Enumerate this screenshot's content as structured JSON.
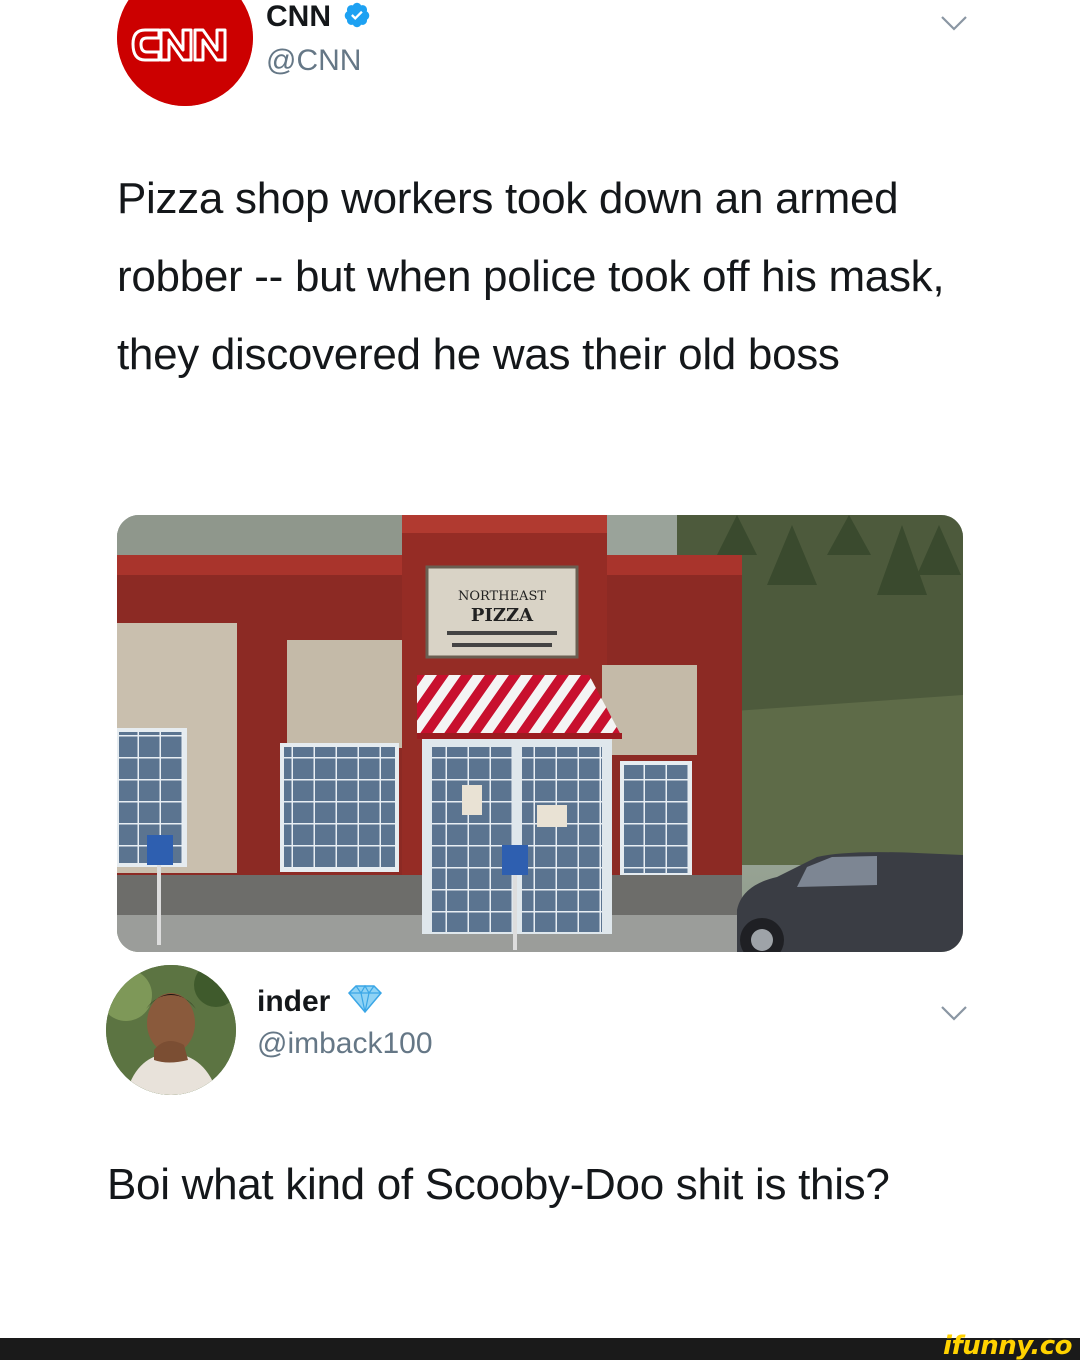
{
  "tweet1": {
    "author_name": "CNN",
    "handle": "@CNN",
    "avatar_logo": "CNN",
    "verified_icon": "verified-badge-icon",
    "text": "Pizza shop workers took down an armed robber -- but when police took off his mask, they discovered he was their old boss",
    "photo": {
      "sign_line1": "NORTHEAST",
      "sign_line2": "PIZZA"
    }
  },
  "tweet2": {
    "author_name": "inder",
    "handle": "@imback100",
    "badge_icon": "diamond-icon",
    "text": "Boi what kind of Scooby-Doo shit is this?"
  },
  "watermark": "ifunny.co",
  "colors": {
    "cnn_red": "#cc0000",
    "verified_blue": "#1da1f2",
    "handle_gray": "#657786",
    "text_dark": "#14171a",
    "watermark_yellow": "#ffd200"
  }
}
